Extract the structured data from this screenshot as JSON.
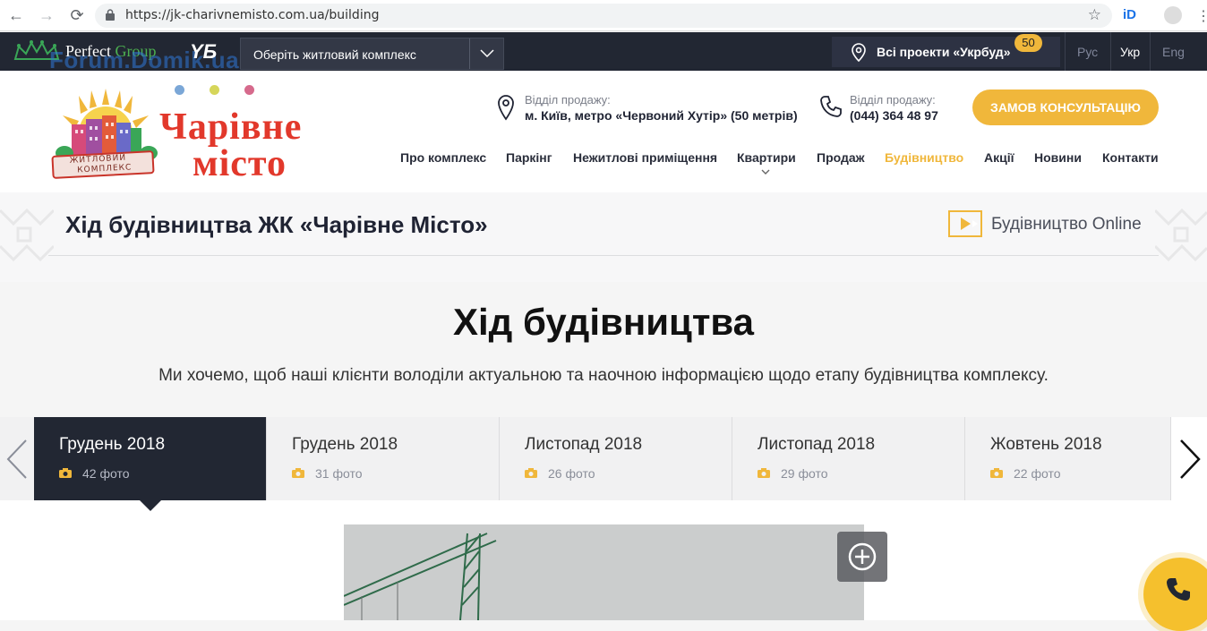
{
  "browser": {
    "url": "https://jk-charivnemisto.com.ua/building",
    "ext_label": "iD"
  },
  "topbar": {
    "brand_name": "Perfect",
    "brand_group": "Group",
    "watermark": "Forum.Domik.ua",
    "yb_logo": "YБ",
    "complex_select_label": "Оберіть житловий комплекс",
    "projects_label": "Всі проекти «Укрбуд»",
    "projects_badge": "50",
    "languages": [
      "Рус",
      "Укр",
      "Eng"
    ],
    "active_language": "Укр"
  },
  "header": {
    "logo_line1": "Чарівне",
    "logo_line2": "місто",
    "logo_ribbon_top": "ЖИТЛОВИЙ",
    "logo_ribbon_bottom": "КОМПЛЕКС",
    "sales_address_caption": "Відділ продажу:",
    "sales_address_value": "м. Київ, метро «Червоний Хутір» (50 метрів)",
    "sales_phone_caption": "Відділ продажу:",
    "sales_phone_value": "(044)  364 48 97",
    "consult_button": "ЗАМОВ КОНСУЛЬТАЦІЮ",
    "menu": [
      "Про комплекс",
      "Паркінг",
      "Нежитлові приміщення",
      "Квартири",
      "Продаж",
      "Будівництво",
      "Акції",
      "Новини",
      "Контакти"
    ],
    "active_menu": "Будівництво"
  },
  "page": {
    "title": "Хід будівництва ЖК «Чарівне Місто»",
    "online_label": "Будівництво Online",
    "main_heading": "Хід будівництва",
    "subtitle": "Ми хочемо, щоб наші клієнти володіли актуальною та наочною інформацією щодо етапу будівництва комплексу."
  },
  "months": [
    {
      "month": "Грудень 2018",
      "photos": "42 фото",
      "active": true
    },
    {
      "month": "Грудень 2018",
      "photos": "31 фото",
      "active": false
    },
    {
      "month": "Листопад 2018",
      "photos": "26 фото",
      "active": false
    },
    {
      "month": "Листопад 2018",
      "photos": "29 фото",
      "active": false
    },
    {
      "month": "Жовтень 2018",
      "photos": "22 фото",
      "active": false
    }
  ],
  "colors": {
    "accent": "#f0b73b",
    "dark": "#222733",
    "logo_red": "#e2382b"
  },
  "icons": {
    "back": "arrow-left-icon",
    "forward": "arrow-right-icon",
    "reload": "reload-icon",
    "lock": "lock-icon",
    "bookmark": "star-icon",
    "location": "pin-icon",
    "phone": "phone-icon",
    "camera": "camera-icon",
    "zoom": "zoom-plus-icon",
    "play": "play-icon"
  }
}
